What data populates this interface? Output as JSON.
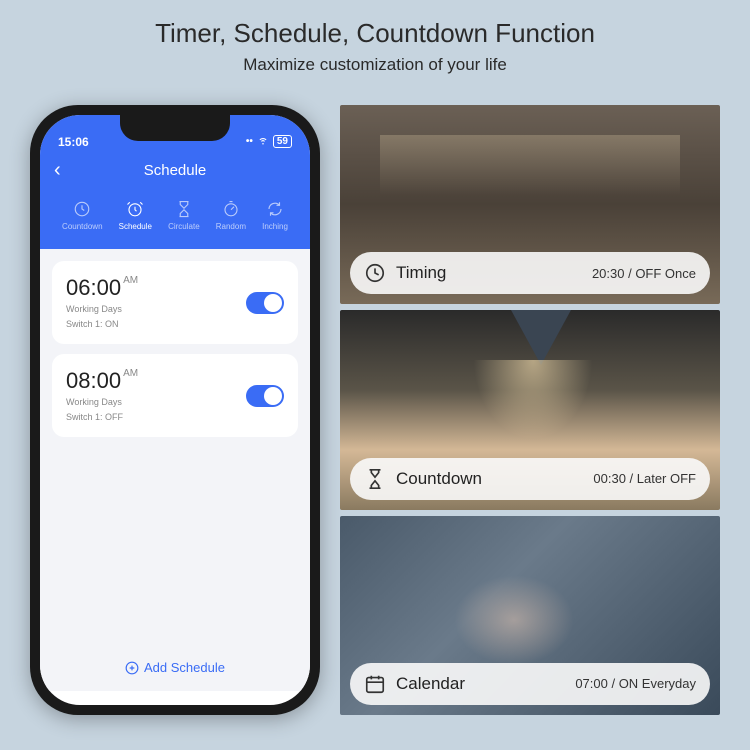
{
  "title": "Timer, Schedule, Countdown Function",
  "subtitle": "Maximize customization of your life",
  "phone": {
    "time": "15:06",
    "battery": "59",
    "header": "Schedule",
    "tabs": [
      {
        "label": "Countdown"
      },
      {
        "label": "Schedule"
      },
      {
        "label": "Circulate"
      },
      {
        "label": "Random"
      },
      {
        "label": "Inching"
      }
    ],
    "items": [
      {
        "time": "06:00",
        "ampm": "AM",
        "days": "Working Days",
        "switch": "Switch 1: ON"
      },
      {
        "time": "08:00",
        "ampm": "AM",
        "days": "Working Days",
        "switch": "Switch 1: OFF"
      }
    ],
    "add": "Add Schedule"
  },
  "panels": [
    {
      "label": "Timing",
      "value": "20:30 / OFF Once"
    },
    {
      "label": "Countdown",
      "value": "00:30 / Later OFF"
    },
    {
      "label": "Calendar",
      "value": "07:00 / ON Everyday"
    }
  ]
}
